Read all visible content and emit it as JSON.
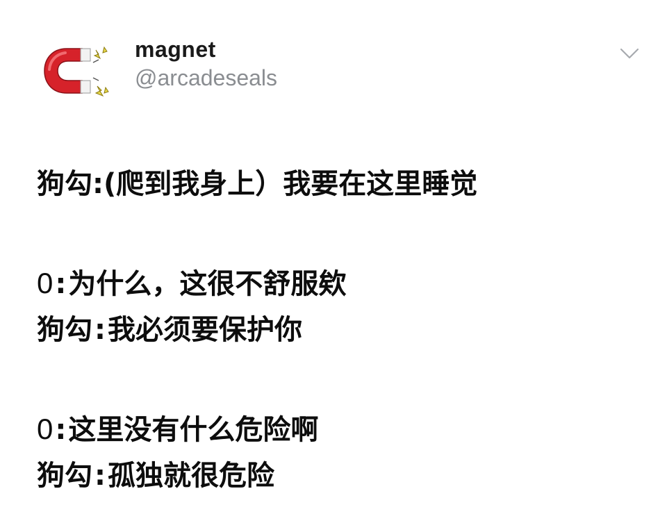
{
  "author": {
    "avatar_icon": "magnet-icon",
    "display_name": "magnet",
    "handle": "@arcadeseals",
    "menu_icon": "chevron-down-icon"
  },
  "post": {
    "lines": [
      {
        "speaker": "狗勾",
        "sep": ":",
        "text": "(爬到我身上）我要在这里睡觉"
      },
      {
        "speaker": "0",
        "sep": ":",
        "text": "为什么，这很不舒服欸"
      },
      {
        "speaker": "狗勾",
        "sep": ":",
        "text": "我必须要保护你"
      },
      {
        "speaker": "0",
        "sep": ":",
        "text": "这里没有什么危险啊"
      },
      {
        "speaker": "狗勾",
        "sep": ":",
        "text": "孤独就很危险"
      }
    ]
  },
  "colors": {
    "magnet_red": "#d6222a",
    "magnet_tip": "#f2f2f2",
    "spark_yellow": "#e8d84a",
    "handle_gray": "#8a8d91"
  }
}
